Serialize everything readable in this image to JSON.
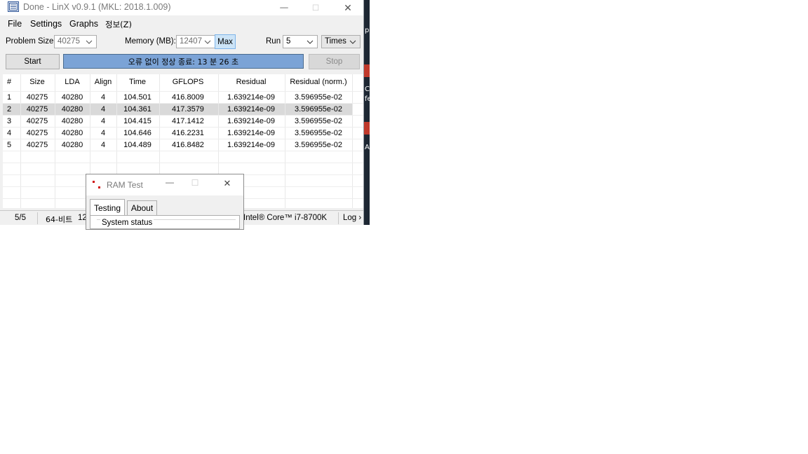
{
  "window": {
    "title": "Done - LinX v0.9.1 (MKL: 2018.1.009)",
    "minimize_glyph": "—",
    "maximize_glyph": "☐",
    "close_glyph": "✕"
  },
  "menu": [
    "File",
    "Settings",
    "Graphs",
    "정보(Z)"
  ],
  "controls": {
    "problem_size_label": "Problem Size:",
    "problem_size_value": "40275",
    "memory_label": "Memory (MB):",
    "memory_value": "12407",
    "max_label": "Max",
    "run_label": "Run",
    "run_value": "5",
    "times_value": "Times",
    "start_label": "Start",
    "progress_text": "오류 없이 정상 종료: 13 분 26 초",
    "progress_fraction": 1.0,
    "stop_label": "Stop"
  },
  "table": {
    "columns": [
      "#",
      "Size",
      "LDA",
      "Align",
      "Time",
      "GFLOPS",
      "Residual",
      "Residual (norm.)"
    ],
    "rows": [
      [
        "1",
        "40275",
        "40280",
        "4",
        "104.501",
        "416.8009",
        "1.639214e-09",
        "3.596955e-02"
      ],
      [
        "2",
        "40275",
        "40280",
        "4",
        "104.361",
        "417.3579",
        "1.639214e-09",
        "3.596955e-02"
      ],
      [
        "3",
        "40275",
        "40280",
        "4",
        "104.415",
        "417.1412",
        "1.639214e-09",
        "3.596955e-02"
      ],
      [
        "4",
        "40275",
        "40280",
        "4",
        "104.646",
        "416.2231",
        "1.639214e-09",
        "3.596955e-02"
      ],
      [
        "5",
        "40275",
        "40280",
        "4",
        "104.489",
        "416.8482",
        "1.639214e-09",
        "3.596955e-02"
      ]
    ],
    "selected_row": 2
  },
  "statusbar": {
    "progress": "5/5",
    "arch": "64-비트",
    "partial": "12",
    "cpu": "Intel® Core™ i7-8700K",
    "log": "Log ›"
  },
  "ram_test": {
    "title": "RAM Test",
    "tabs": [
      "Testing",
      "About"
    ],
    "group_label": "System status"
  },
  "desktop": {
    "fragments": [
      "p",
      "C",
      "fe",
      "A"
    ]
  },
  "colors": {
    "progress_fill": "#7ba3d6",
    "selected_row": "#d9d9d9",
    "max_button": "#cce4f7"
  }
}
